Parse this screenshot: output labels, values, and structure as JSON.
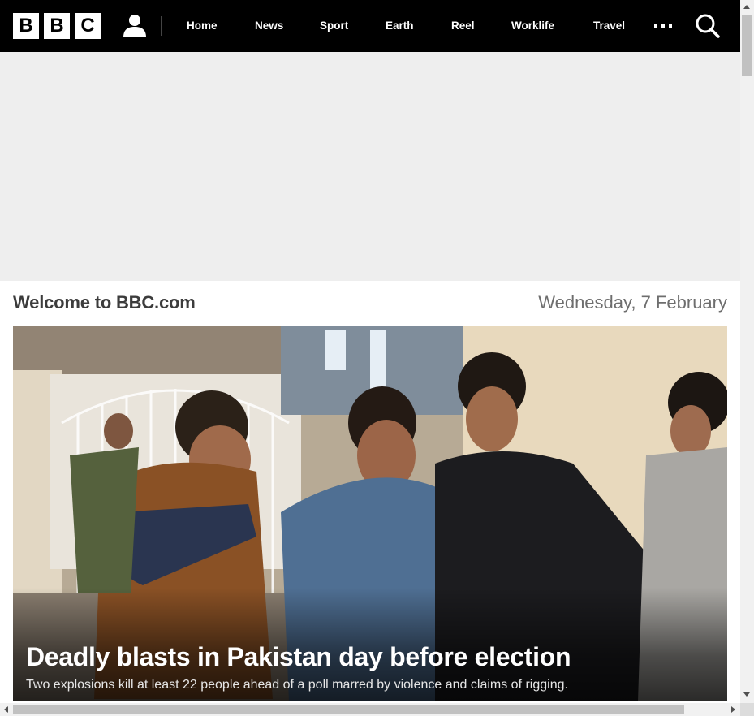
{
  "header": {
    "logo_letters": [
      "B",
      "B",
      "C"
    ],
    "account_icon": "person-icon",
    "nav": [
      "Home",
      "News",
      "Sport",
      "Earth",
      "Reel",
      "Worklife",
      "Travel"
    ],
    "more_icon": "ellipsis-icon",
    "search_icon": "search-icon"
  },
  "welcome": {
    "title": "Welcome to BBC.com",
    "date": "Wednesday, 7 February"
  },
  "hero": {
    "headline": "Deadly blasts in Pakistan day before election",
    "summary": "Two explosions kill at least 22 people ahead of a poll marred by violence and claims of rigging."
  },
  "colors": {
    "topbar": "#000000",
    "ad_background": "#eeeeee",
    "welcome_text": "#3c3c3c",
    "date_text": "#6e6e6e"
  }
}
